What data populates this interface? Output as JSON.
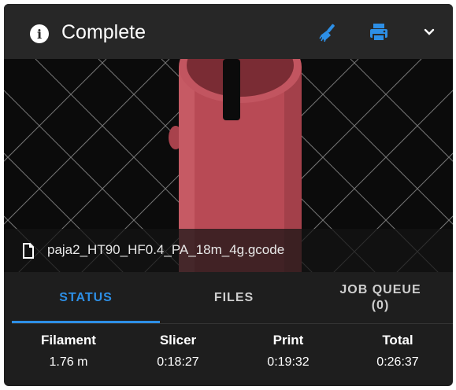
{
  "header": {
    "title": "Complete",
    "icons": [
      "info-icon",
      "broom-icon",
      "printer-icon",
      "chevron-down-icon"
    ],
    "accent_color": "#2d8fe6"
  },
  "thumbnail": {
    "filename": "paja2_HT90_HF0.4_PA_18m_4g.gcode",
    "model_color": "#b84a55"
  },
  "tabs": [
    {
      "label": "STATUS",
      "active": true
    },
    {
      "label": "FILES",
      "active": false
    },
    {
      "label": "JOB QUEUE (0)",
      "active": false
    }
  ],
  "stats": [
    {
      "label": "Filament",
      "value": "1.76 m"
    },
    {
      "label": "Slicer",
      "value": "0:18:27"
    },
    {
      "label": "Print",
      "value": "0:19:32"
    },
    {
      "label": "Total",
      "value": "0:26:37"
    }
  ]
}
